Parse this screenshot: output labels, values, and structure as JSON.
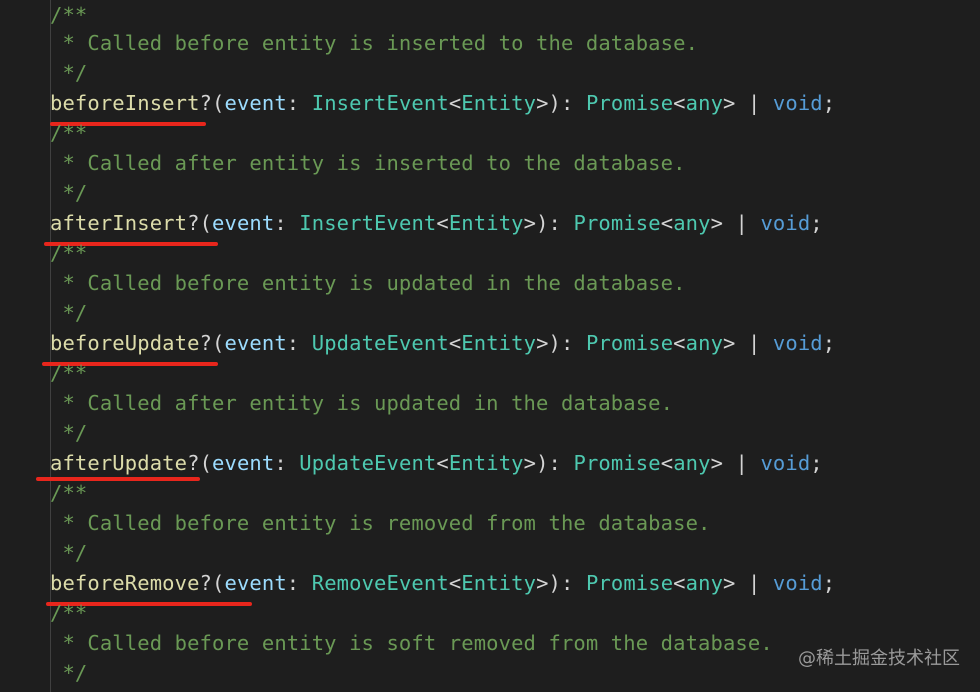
{
  "code": {
    "blocks": [
      {
        "comment_open": "/**",
        "comment_body": " * Called before entity is inserted to the database.",
        "comment_close": " */",
        "method": "beforeInsert",
        "event_type": "InsertEvent"
      },
      {
        "comment_open": "/**",
        "comment_body": " * Called after entity is inserted to the database.",
        "comment_close": " */",
        "method": "afterInsert",
        "event_type": "InsertEvent"
      },
      {
        "comment_open": "/**",
        "comment_body": " * Called before entity is updated in the database.",
        "comment_close": " */",
        "method": "beforeUpdate",
        "event_type": "UpdateEvent"
      },
      {
        "comment_open": "/**",
        "comment_body": " * Called after entity is updated in the database.",
        "comment_close": " */",
        "method": "afterUpdate",
        "event_type": "UpdateEvent"
      },
      {
        "comment_open": "/**",
        "comment_body": " * Called before entity is removed from the database.",
        "comment_close": " */",
        "method": "beforeRemove",
        "event_type": "RemoveEvent"
      },
      {
        "comment_open": "/**",
        "comment_body": " * Called before entity is soft removed from the database.",
        "comment_close": " */"
      }
    ],
    "tokens": {
      "optional": "?",
      "open_paren": "(",
      "param": "event",
      "colon": ": ",
      "lt": "<",
      "entity": "Entity",
      "gt_close": ">): ",
      "promise": "Promise",
      "any": "any",
      "gt": ">",
      "pipe": " | ",
      "void": "void",
      "semicolon": ";"
    }
  },
  "colors": {
    "background": "#1e1e1e",
    "comment": "#6a9955",
    "function": "#dcdcaa",
    "parameter": "#9cdcfe",
    "type": "#4ec9b0",
    "keyword": "#569cd6",
    "punctuation": "#d4d4d4",
    "annotation_underline": "#e8261c"
  },
  "watermark": {
    "text": "@稀土掘金技术社区"
  }
}
